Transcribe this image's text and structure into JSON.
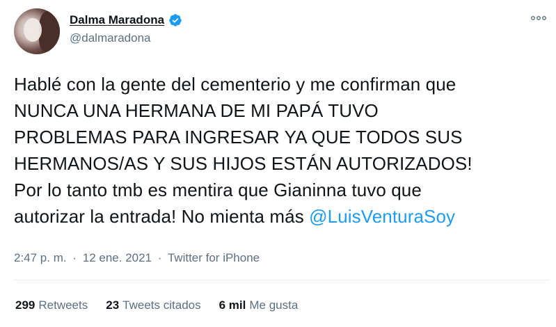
{
  "author": {
    "display_name": "Dalma Maradona",
    "handle": "@dalmaradona",
    "verified": true,
    "avatar_icon": "avatar-photo"
  },
  "tweet": {
    "lines": [
      "Hablé con la gente del cementerio y me confirman que",
      "NUNCA UNA HERMANA DE MI PAPÁ TUVO",
      "PROBLEMAS PARA INGRESAR YA QUE TODOS SUS",
      "HERMANOS/AS Y SUS HIJOS ESTÁN AUTORIZADOS!",
      "Por lo tanto tmb es mentira que Gianinna tuvo que"
    ],
    "last_line_text": "autorizar la entrada! No mienta más ",
    "mention": "@LuisVenturaSoy"
  },
  "meta": {
    "time": "2:47 p. m.",
    "separator": "·",
    "date": "12 ene. 2021",
    "source": "Twitter for iPhone"
  },
  "stats": {
    "retweets_count": "299",
    "retweets_label": "Retweets",
    "quotes_count": "23",
    "quotes_label": "Tweets citados",
    "likes_count": "6 mil",
    "likes_label": "Me gusta"
  },
  "colors": {
    "accent": "#1d9bf0",
    "secondary_text": "#5b7083",
    "primary_text": "#0f1419"
  },
  "icons": {
    "verified": "verified-badge-icon",
    "more": "more-options-icon"
  }
}
